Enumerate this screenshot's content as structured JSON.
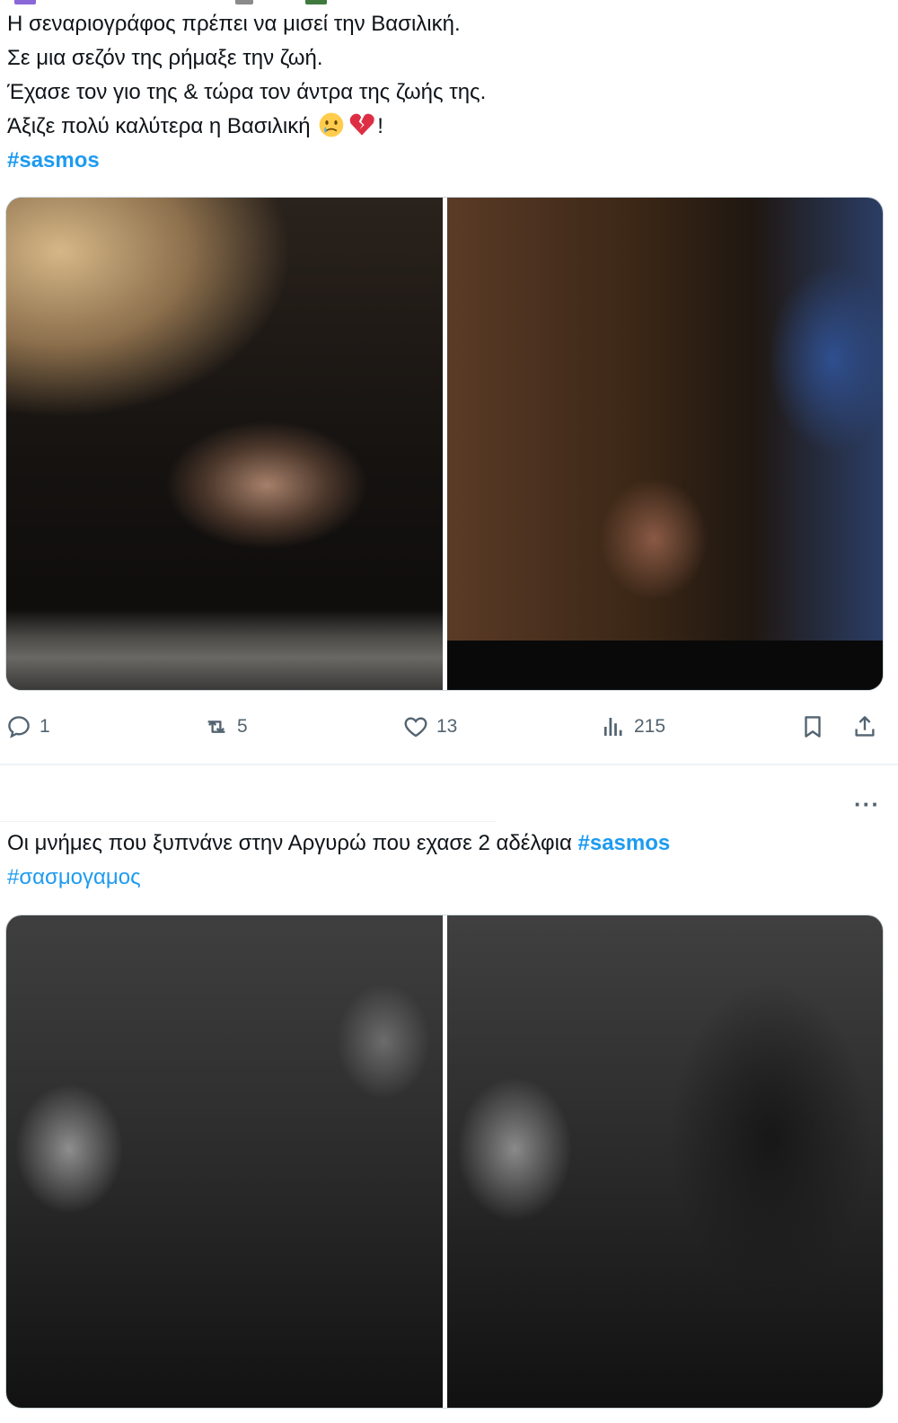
{
  "tweet1": {
    "text_lines": [
      "Η σεναριογράφος πρέπει να μισεί την Βασιλική.",
      "Σε μια σεζόν της ρήμαξε την ζωή.",
      "Έχασε τον γιο της & τώρα τον άντρα της ζωής της."
    ],
    "last_line_text": "Άξιζε πολύ καλύτερα η Βασιλική",
    "last_line_suffix": "!",
    "emojis": [
      "crying-face-emoji",
      "broken-heart-emoji"
    ],
    "hashtag": "#sasmos",
    "media": [
      "photo-woman-crying",
      "photo-women-flowers"
    ],
    "actions": {
      "replies": "1",
      "reposts": "5",
      "likes": "13",
      "views": "215"
    }
  },
  "tweet2": {
    "more_label": "···",
    "text_main": "Οι μνήμες που ξυπνάνε στην Αργυρώ που εχασε 2 αδέλφια",
    "hashtag_inline": "#sasmos",
    "hashtag_line2": "#σασμογαμος",
    "media": [
      "photo-woman-man-1",
      "photo-woman-man-2"
    ]
  },
  "colors": {
    "accent": "#1d9bf0",
    "text": "#0f1419",
    "muted": "#536471",
    "border": "#cfd9de"
  },
  "icons": [
    "reply-icon",
    "repost-icon",
    "like-icon",
    "views-icon",
    "bookmark-icon",
    "share-icon",
    "more-icon"
  ]
}
